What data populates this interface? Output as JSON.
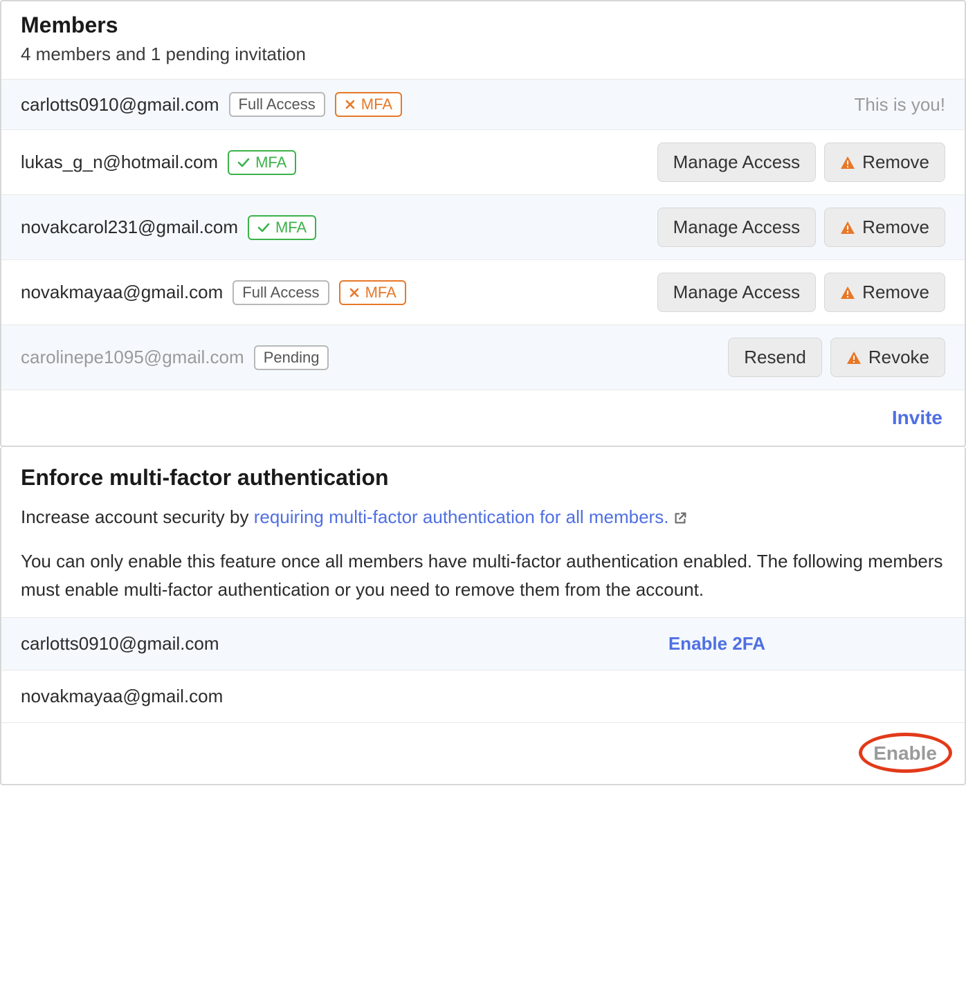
{
  "members_section": {
    "title": "Members",
    "subtitle": "4 members and 1 pending invitation",
    "rows": [
      {
        "email": "carlotts0910@gmail.com",
        "access_badge": "Full Access",
        "mfa_label": "MFA",
        "note": "This is you!"
      },
      {
        "email": "lukas_g_n@hotmail.com",
        "mfa_label": "MFA",
        "manage_label": "Manage Access",
        "remove_label": "Remove"
      },
      {
        "email": "novakcarol231@gmail.com",
        "mfa_label": "MFA",
        "manage_label": "Manage Access",
        "remove_label": "Remove"
      },
      {
        "email": "novakmayaa@gmail.com",
        "access_badge": "Full Access",
        "mfa_label": "MFA",
        "manage_label": "Manage Access",
        "remove_label": "Remove"
      },
      {
        "email": "carolinepe1095@gmail.com",
        "pending_badge": "Pending",
        "resend_label": "Resend",
        "revoke_label": "Revoke"
      }
    ],
    "invite_label": "Invite"
  },
  "mfa_section": {
    "title": "Enforce multi-factor authentication",
    "desc_prefix": "Increase account security by ",
    "desc_link": "requiring multi-factor authentication for all members.",
    "desc_warning": "You can only enable this feature once all members have multi-factor authentication enabled. The following members must enable multi-factor authentication or you need to remove them from the account.",
    "rows": [
      {
        "email": "carlotts0910@gmail.com",
        "action": "Enable 2FA"
      },
      {
        "email": "novakmayaa@gmail.com"
      }
    ],
    "enable_label": "Enable"
  }
}
